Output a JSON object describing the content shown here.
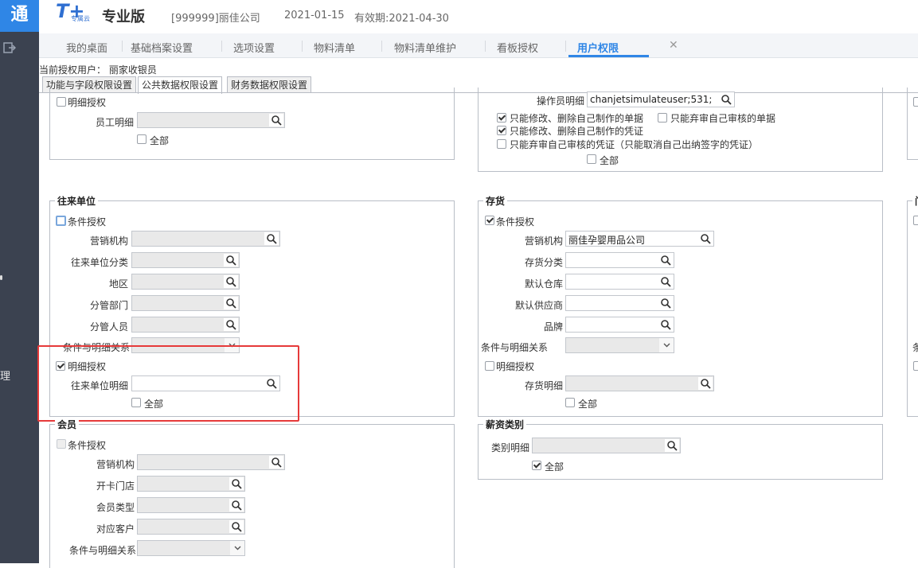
{
  "app": {
    "logo_glyph": "通",
    "brand_mark": "T+",
    "brand_sub": "专属云",
    "brand_name": "专业版",
    "company": "[999999]丽佳公司",
    "date": "2021-01-15",
    "expire": "有效期:2021-04-30"
  },
  "sidebar": {
    "visible_text": "理"
  },
  "tabs": [
    {
      "label": "我的桌面"
    },
    {
      "label": "基础档案设置"
    },
    {
      "label": "选项设置"
    },
    {
      "label": "物料清单"
    },
    {
      "label": "物料清单维护"
    },
    {
      "label": "看板授权"
    },
    {
      "label": "用户权限"
    }
  ],
  "tab_close_glyph": "✕",
  "current_user": "当前授权用户： 丽家收银员",
  "subtabs": [
    {
      "label": "功能与字段权限设置"
    },
    {
      "label": "公共数据权限设置"
    },
    {
      "label": "财务数据权限设置"
    }
  ],
  "employee": {
    "detail_auth": "明细授权",
    "employee_detail": "员工明细",
    "all": "全部"
  },
  "operator": {
    "operator_detail": "操作员明细",
    "operator_value": "chanjetsimulateuser;531;",
    "opt1": "只能修改、删除自己制作的单据",
    "opt2": "只能弃审自己审核的单据",
    "opt3": "只能修改、删除自己制作的凭证",
    "opt4": "只能弃审自己审核的凭证（只能取消自己出纳签字的凭证）",
    "all": "全部"
  },
  "partner": {
    "title": "往来单位",
    "cond_auth": "条件授权",
    "sales_org": "营销机构",
    "partner_class": "往来单位分类",
    "region": "地区",
    "dept": "分管部门",
    "staff": "分管人员",
    "relation": "条件与明细关系",
    "detail_auth": "明细授权",
    "partner_detail": "往来单位明细",
    "all": "全部"
  },
  "inventory": {
    "title": "存货",
    "cond_auth": "条件授权",
    "sales_org": "营销机构",
    "sales_org_value": "丽佳孕婴用品公司",
    "inv_class": "存货分类",
    "default_wh": "默认仓库",
    "default_supplier": "默认供应商",
    "brand": "品牌",
    "relation": "条件与明细关系",
    "detail_auth": "明细授权",
    "inv_detail": "存货明细",
    "all": "全部"
  },
  "member": {
    "title": "会员",
    "cond_auth": "条件授权",
    "sales_org": "营销机构",
    "card_store": "开卡门店",
    "member_type": "会员类型",
    "customer": "对应客户",
    "relation": "条件与明细关系"
  },
  "salary": {
    "title": "薪资类别",
    "class_detail": "类别明细",
    "all": "全部"
  },
  "right_edge": {
    "frag1": "门",
    "frag2": "条"
  }
}
